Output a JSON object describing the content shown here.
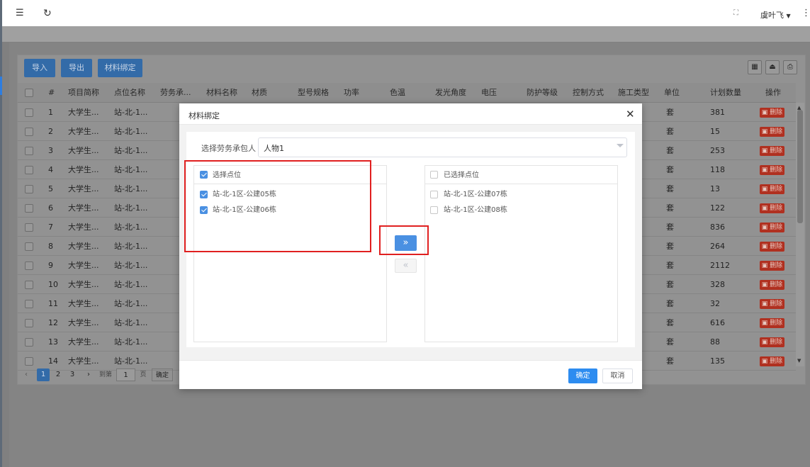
{
  "topbar": {
    "menu_icon": "menu-fold-icon",
    "refresh_icon": "refresh-icon",
    "fullscreen_icon": "fullscreen-icon",
    "user": "虞叶飞",
    "more_icon": "more-vertical-icon"
  },
  "toolbar": {
    "import_label": "导入",
    "export_label": "导出",
    "bind_label": "材料绑定",
    "right_icons": [
      "grid-icon",
      "upload-icon",
      "print-icon"
    ]
  },
  "table": {
    "columns": [
      "#",
      "项目简称",
      "点位名称",
      "劳务承...",
      "材料名称",
      "材质",
      "型号规格",
      "功率",
      "色温",
      "发光角度",
      "电压",
      "防护等级",
      "控制方式",
      "施工类型",
      "单位",
      "计划数量",
      "操作"
    ],
    "rows": [
      {
        "no": "1",
        "project": "大学生...",
        "point": "站-北-1...",
        "unit": "套",
        "qty": "381"
      },
      {
        "no": "2",
        "project": "大学生...",
        "point": "站-北-1...",
        "unit": "套",
        "qty": "15"
      },
      {
        "no": "3",
        "project": "大学生...",
        "point": "站-北-1...",
        "unit": "套",
        "qty": "253"
      },
      {
        "no": "4",
        "project": "大学生...",
        "point": "站-北-1...",
        "unit": "套",
        "qty": "118"
      },
      {
        "no": "5",
        "project": "大学生...",
        "point": "站-北-1...",
        "unit": "套",
        "qty": "13"
      },
      {
        "no": "6",
        "project": "大学生...",
        "point": "站-北-1...",
        "unit": "套",
        "qty": "122"
      },
      {
        "no": "7",
        "project": "大学生...",
        "point": "站-北-1...",
        "unit": "套",
        "qty": "836"
      },
      {
        "no": "8",
        "project": "大学生...",
        "point": "站-北-1...",
        "unit": "套",
        "qty": "264"
      },
      {
        "no": "9",
        "project": "大学生...",
        "point": "站-北-1...",
        "unit": "套",
        "qty": "2112"
      },
      {
        "no": "10",
        "project": "大学生...",
        "point": "站-北-1...",
        "unit": "套",
        "qty": "328"
      },
      {
        "no": "11",
        "project": "大学生...",
        "point": "站-北-1...",
        "unit": "套",
        "qty": "32"
      },
      {
        "no": "12",
        "project": "大学生...",
        "point": "站-北-1...",
        "unit": "套",
        "qty": "616"
      },
      {
        "no": "13",
        "project": "大学生...",
        "point": "站-北-1...",
        "unit": "套",
        "qty": "88"
      },
      {
        "no": "14",
        "project": "大学生...",
        "point": "站-北-1...",
        "unit": "套",
        "qty": "135"
      }
    ],
    "delete_label": "删除"
  },
  "pager": {
    "pages": [
      "1",
      "2",
      "3"
    ],
    "current": "1",
    "goto_prefix": "到第",
    "goto_value": "1",
    "goto_suffix": "页",
    "confirm": "确定"
  },
  "modal": {
    "title": "材料绑定",
    "contractor_label": "选择劳务承包人",
    "contractor_value": "人物1",
    "left_panel": {
      "title": "选择点位",
      "checked": true,
      "items": [
        {
          "label": "站-北-1区-公建05栋",
          "checked": true
        },
        {
          "label": "站-北-1区-公建06栋",
          "checked": true
        }
      ]
    },
    "right_panel": {
      "title": "已选择点位",
      "checked": false,
      "items": [
        {
          "label": "站-北-1区-公建07栋",
          "checked": false
        },
        {
          "label": "站-北-1区-公建08栋",
          "checked": false
        }
      ]
    },
    "move_right": "»",
    "move_left": "«",
    "ok_label": "确定",
    "cancel_label": "取消"
  },
  "colors": {
    "primary": "#2d8cf0",
    "highlight": "#e02020",
    "delete": "#b03020"
  }
}
